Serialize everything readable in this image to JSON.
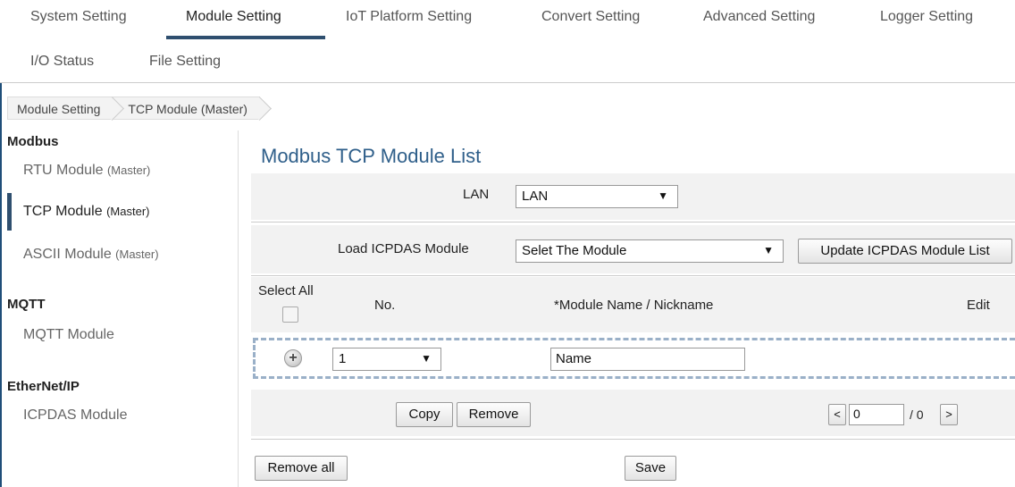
{
  "nav": {
    "tabs": [
      {
        "label": "System Setting"
      },
      {
        "label": "Module Setting"
      },
      {
        "label": "IoT Platform Setting"
      },
      {
        "label": "Convert Setting"
      },
      {
        "label": "Advanced Setting"
      },
      {
        "label": "Logger Setting"
      },
      {
        "label": "I/O Status"
      },
      {
        "label": "File Setting"
      }
    ],
    "active_tab": "Module Setting"
  },
  "breadcrumb": [
    "Module Setting",
    "TCP Module (Master)"
  ],
  "sidebar": {
    "groups": [
      {
        "title": "Modbus",
        "items": [
          {
            "label": "RTU Module",
            "suffix": "(Master)"
          },
          {
            "label": "TCP Module",
            "suffix": "(Master)",
            "active": true
          },
          {
            "label": "ASCII Module",
            "suffix": "(Master)"
          }
        ]
      },
      {
        "title": "MQTT",
        "items": [
          {
            "label": "MQTT Module",
            "suffix": ""
          }
        ]
      },
      {
        "title": "EtherNet/IP",
        "items": [
          {
            "label": "ICPDAS Module",
            "suffix": ""
          }
        ]
      }
    ]
  },
  "main": {
    "title": "Modbus TCP Module List",
    "lan": {
      "label": "LAN",
      "value": "LAN"
    },
    "load_module": {
      "label": "Load ICPDAS Module",
      "value": "Selet The Module",
      "update_button": "Update ICPDAS Module List"
    },
    "table": {
      "select_all": "Select All",
      "col_no": "No.",
      "col_name": "*Module Name / Nickname",
      "col_edit": "Edit",
      "new_row": {
        "no_value": "1",
        "name_value": "Name"
      }
    },
    "copy_button": "Copy",
    "remove_button": "Remove",
    "pager": {
      "prev": "<",
      "next": ">",
      "page_value": "0",
      "total": "/ 0"
    },
    "remove_all_button": "Remove all",
    "save_button": "Save"
  },
  "colors": {
    "accent": "#2f4f6f",
    "title": "#2f5f8a",
    "row_bg": "#f2f2f2",
    "dashed": "#9ab0c8"
  }
}
